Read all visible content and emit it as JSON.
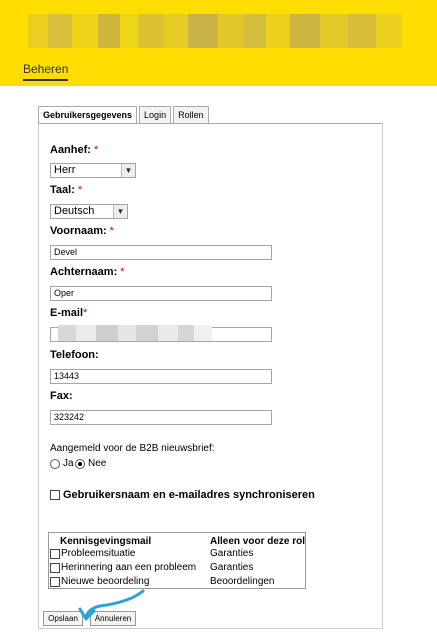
{
  "header": {
    "nav_active": "Beheren"
  },
  "tabs": [
    {
      "label": "Gebruikersgegevens"
    },
    {
      "label": "Login"
    },
    {
      "label": "Rollen"
    }
  ],
  "form": {
    "salutation": {
      "label": "Aanhef:",
      "required": "*",
      "value": "Herr"
    },
    "language": {
      "label": "Taal:",
      "required": "*",
      "value": "Deutsch"
    },
    "firstname": {
      "label": "Voornaam:",
      "required": "*",
      "value": "Devel"
    },
    "lastname": {
      "label": "Achternaam:",
      "required": "*",
      "value": "Oper"
    },
    "email": {
      "label": "E-mail",
      "required": "*",
      "value": ""
    },
    "phone": {
      "label": "Telefoon:",
      "value": "13443"
    },
    "fax": {
      "label": "Fax:",
      "value": "323242"
    },
    "newsletter": {
      "label": "Aangemeld voor de B2B nieuwsbrief:",
      "options": [
        "Ja",
        "Nee"
      ],
      "selected": "Nee"
    },
    "sync": {
      "label": "Gebruikersnaam en e-mailadres synchroniseren",
      "checked": false
    }
  },
  "notifications": {
    "headers": [
      "Kennisgevingsmail",
      "Alleen voor deze rol"
    ],
    "rows": [
      {
        "name": "Probleemsituatie",
        "role": "Garanties",
        "checked": false
      },
      {
        "name": "Herinnering aan een probleem",
        "role": "Garanties",
        "checked": false
      },
      {
        "name": "Nieuwe beoordeling",
        "role": "Beoordelingen",
        "checked": false
      }
    ]
  },
  "buttons": {
    "save": "Opslaan",
    "cancel": "Annuleren"
  },
  "colors": {
    "header_bg": "#ffdd00",
    "required": "#cc0000",
    "annotation_arrow": "#2aa3d8"
  }
}
